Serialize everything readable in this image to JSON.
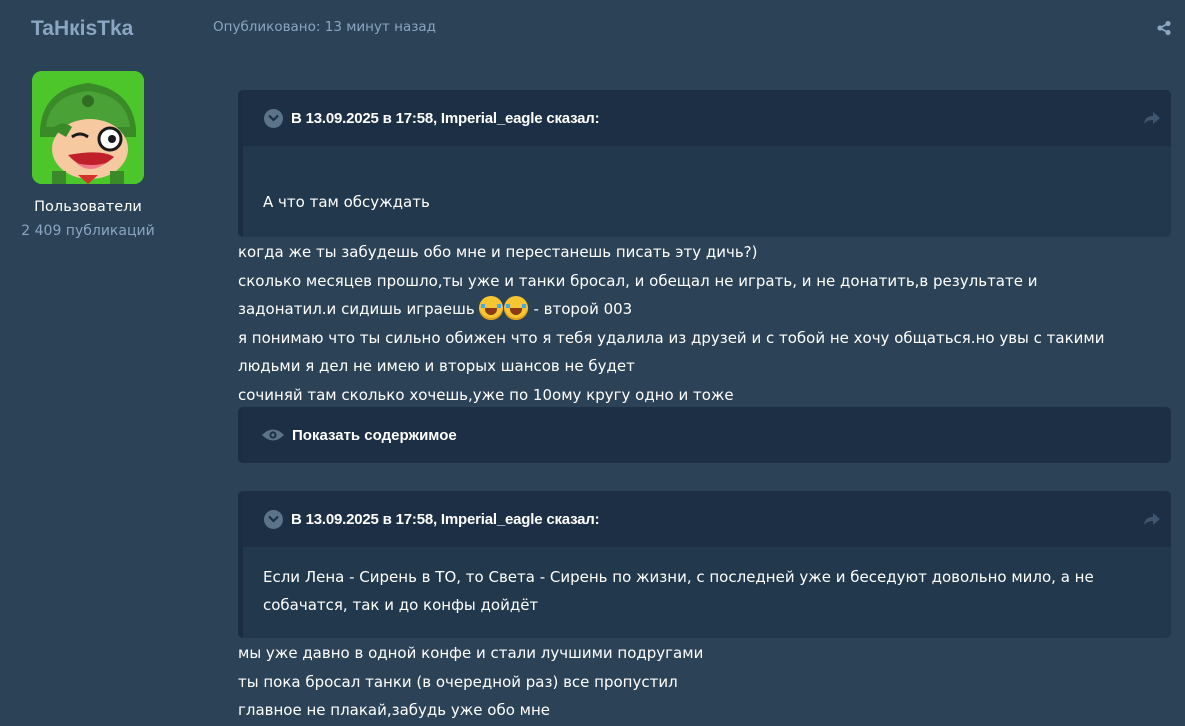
{
  "author": {
    "name": "TaHкisTka",
    "group": "Пользователи",
    "posts": "2 409 публикаций"
  },
  "post": {
    "meta": "Опубликовано: 13 минут назад"
  },
  "quote1": {
    "header": "В 13.09.2025 в 17:58, Imperial_eagle сказал:",
    "body": "А что там обсуждать"
  },
  "text1": {
    "line1": "когда же ты забудешь обо мне и перестанешь писать эту дичь?)",
    "line2": "сколько месяцев прошло,ты уже и танки бросал, и обещал не играть, и не донатить,в результате и",
    "line3a": "задонатил.и сидишь играешь",
    "line3b": " - второй 003",
    "line4": "я понимаю что ты сильно обижен что я тебя удалила из друзей и с тобой не хочу общаться.но увы с такими",
    "line5": "людьми я дел не имею и вторых шансов не будет",
    "line6": "сочиняй там сколько хочешь,уже по 10ому кругу одно и тоже"
  },
  "spoiler": {
    "label": "Показать содержимое"
  },
  "quote2": {
    "header": "В 13.09.2025 в 17:58, Imperial_eagle сказал:",
    "body_line1": "Если Лена - Сирень в ТО, то Света - Сирень по жизни, с последней уже и беседуют довольно мило, а не",
    "body_line2": "собачатся, так и до конфы дойдёт"
  },
  "text2": {
    "line1": "мы уже давно в одной конфе и стали лучшими подругами",
    "line2": "ты пока бросал танки (в очередной раз) все пропустил",
    "line3": "главное не плакай,забудь уже обо мне"
  },
  "icons": {
    "share": "share-icon",
    "chevron": "chevron-down-icon",
    "reply": "reply-arrow-icon",
    "eye": "eye-icon",
    "emoji": "laughing-tears-emoji"
  },
  "colors": {
    "background": "#2c4257",
    "quote_header": "#1c2f44",
    "quote_body": "#22384d",
    "muted_text": "#8aa6c2"
  }
}
